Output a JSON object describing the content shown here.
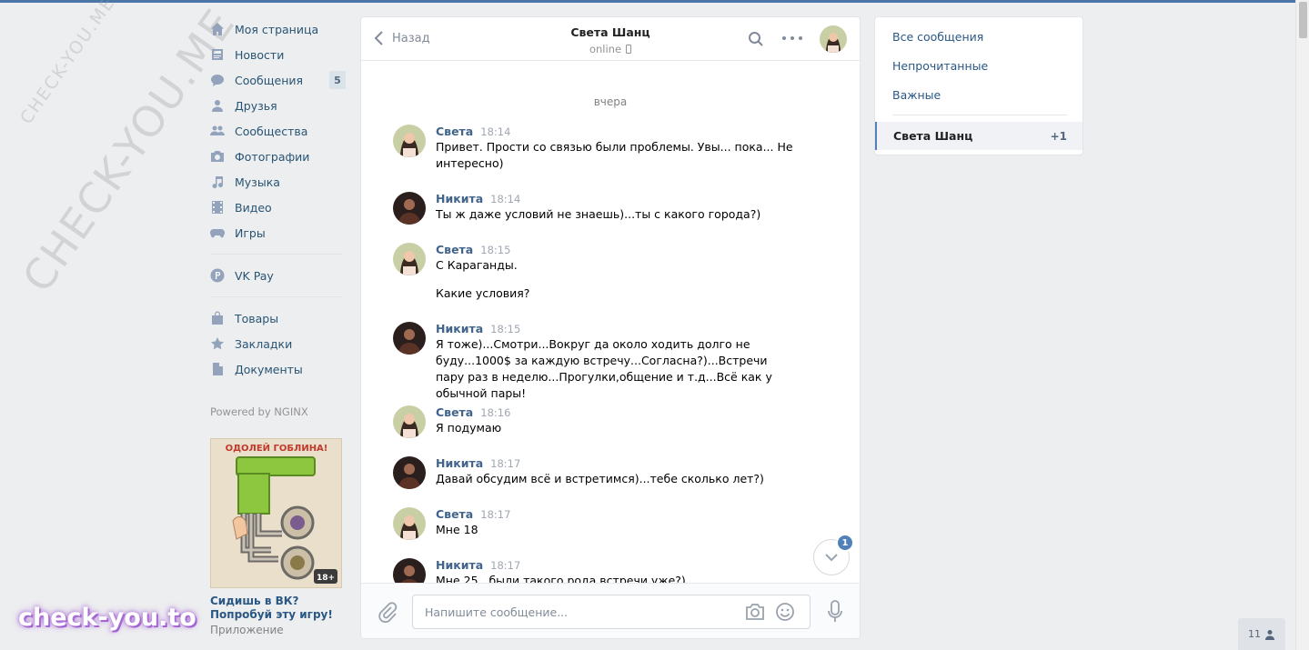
{
  "colors": {
    "accent": "#4a76a8",
    "link": "#2a5885",
    "author": "#42648b",
    "badge": "#5181b8"
  },
  "watermarks": {
    "big": "CHECK-YOU.ME",
    "small": "CHECK-YOU.ME",
    "logo": "check-you.to"
  },
  "leftnav": {
    "items": [
      {
        "label": "Моя страница",
        "icon": "home-icon"
      },
      {
        "label": "Новости",
        "icon": "news-icon"
      },
      {
        "label": "Сообщения",
        "icon": "messages-icon",
        "count": "5"
      },
      {
        "label": "Друзья",
        "icon": "friends-icon"
      },
      {
        "label": "Сообщества",
        "icon": "communities-icon"
      },
      {
        "label": "Фотографии",
        "icon": "camera-icon"
      },
      {
        "label": "Музыка",
        "icon": "music-icon"
      },
      {
        "label": "Видео",
        "icon": "video-icon"
      },
      {
        "label": "Игры",
        "icon": "gamepad-icon"
      },
      {
        "label": "VK Pay",
        "icon": "vkpay-icon"
      },
      {
        "label": "Товары",
        "icon": "bag-icon"
      },
      {
        "label": "Закладки",
        "icon": "star-icon"
      },
      {
        "label": "Документы",
        "icon": "document-icon"
      }
    ],
    "powered": "Powered by NGINX",
    "ad": {
      "banner": "ОДОЛЕЙ ГОБЛИНА!",
      "age": "18+",
      "title": "Сидишь в ВК? Попробуй эту игру!",
      "subtitle": "Приложение"
    }
  },
  "chat": {
    "back_label": "Назад",
    "peer_name": "Света Шанц",
    "peer_status": "online",
    "day_separator": "вчера",
    "messages": [
      {
        "author": "Света",
        "time": "18:14",
        "texts": [
          "Привет. Прости со связью были проблемы. Увы... пока... Не интересно)"
        ]
      },
      {
        "author": "Никита",
        "time": "18:14",
        "texts": [
          "Ты ж даже условий не знаешь)...ты с какого города?)"
        ]
      },
      {
        "author": "Света",
        "time": "18:15",
        "texts": [
          "С Караганды.",
          "Какие условия?"
        ]
      },
      {
        "author": "Никита",
        "time": "18:15",
        "texts": [
          "Я тоже)...Смотри...Вокруг да около ходить долго не буду...1000$ за каждую встречу...Согласна?)...Встречи пару раз в неделю...Прогулки,общение и т.д...Всё как у обычной пары!"
        ]
      },
      {
        "author": "Света",
        "time": "18:16",
        "texts": [
          "Я подумаю"
        ]
      },
      {
        "author": "Никита",
        "time": "18:17",
        "texts": [
          "Давай обсудим всё и встретимся)...тебе сколько лет?)"
        ]
      },
      {
        "author": "Света",
        "time": "18:17",
        "texts": [
          "Мне 18"
        ]
      },
      {
        "author": "Никита",
        "time": "18:17",
        "texts": [
          "Мне 25...были такого рода встречи уже?)"
        ]
      }
    ],
    "unread_badge": "1",
    "composer_placeholder": "Напишите сообщение..."
  },
  "rightpanel": {
    "filters": [
      "Все сообщения",
      "Непрочитанные",
      "Важные"
    ],
    "active_dialog": {
      "name": "Света Шанц",
      "count": "+1"
    }
  },
  "online_count": "11"
}
